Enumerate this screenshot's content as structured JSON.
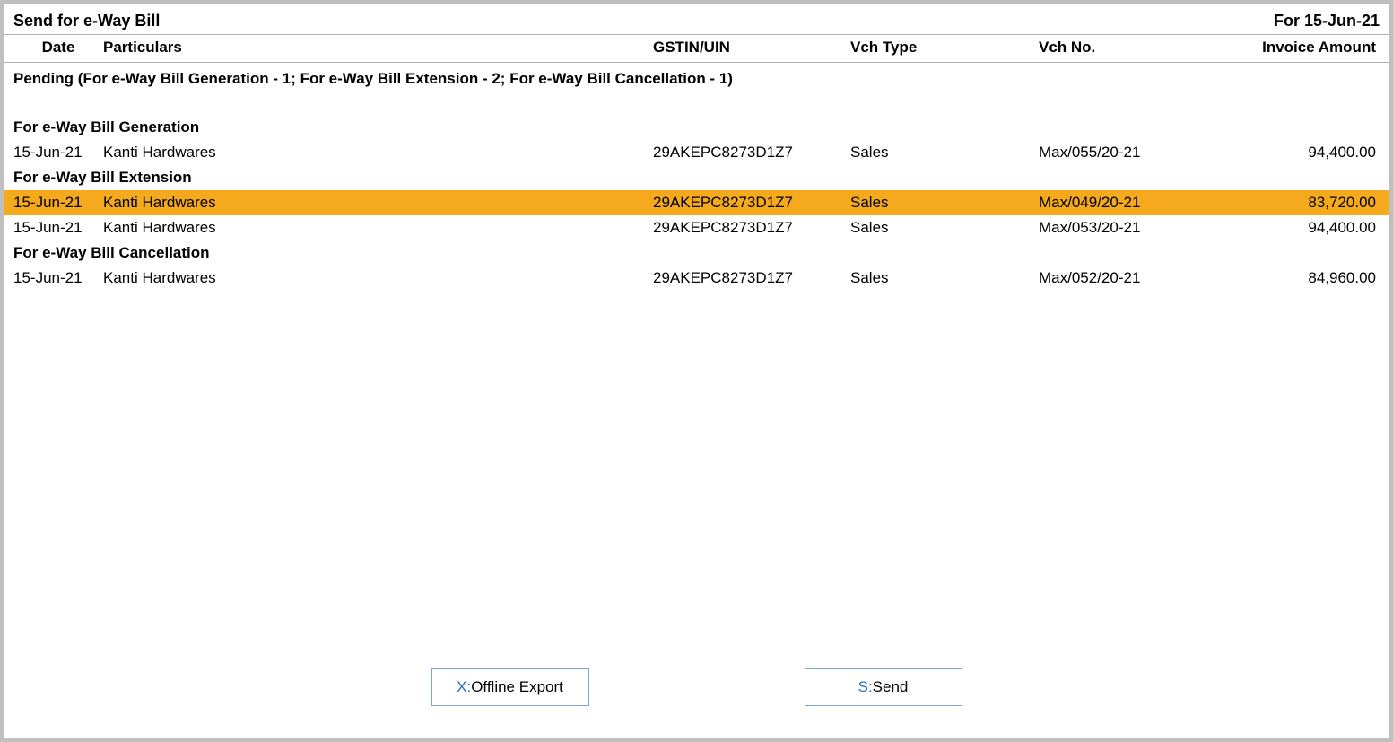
{
  "header": {
    "title": "Send for e-Way Bill",
    "date_label": "For 15-Jun-21"
  },
  "columns": {
    "date": "Date",
    "particulars": "Particulars",
    "gstin": "GSTIN/UIN",
    "vchtype": "Vch Type",
    "vchno": "Vch No.",
    "amount": "Invoice Amount"
  },
  "summary": "Pending (For e-Way Bill Generation - 1; For e-Way Bill Extension - 2; For e-Way Bill Cancellation - 1)",
  "sections": [
    {
      "title": "For e-Way Bill Generation",
      "rows": [
        {
          "date": "15-Jun-21",
          "particulars": "Kanti Hardwares",
          "gstin": "29AKEPC8273D1Z7",
          "vchtype": "Sales",
          "vchno": "Max/055/20-21",
          "amount": "94,400.00",
          "selected": false
        }
      ]
    },
    {
      "title": "For e-Way Bill Extension",
      "rows": [
        {
          "date": "15-Jun-21",
          "particulars": "Kanti Hardwares",
          "gstin": "29AKEPC8273D1Z7",
          "vchtype": "Sales",
          "vchno": "Max/049/20-21",
          "amount": "83,720.00",
          "selected": true
        },
        {
          "date": "15-Jun-21",
          "particulars": "Kanti Hardwares",
          "gstin": "29AKEPC8273D1Z7",
          "vchtype": "Sales",
          "vchno": "Max/053/20-21",
          "amount": "94,400.00",
          "selected": false
        }
      ]
    },
    {
      "title": "For e-Way Bill Cancellation",
      "rows": [
        {
          "date": "15-Jun-21",
          "particulars": "Kanti Hardwares",
          "gstin": "29AKEPC8273D1Z7",
          "vchtype": "Sales",
          "vchno": "Max/052/20-21",
          "amount": "84,960.00",
          "selected": false
        }
      ]
    }
  ],
  "footer": {
    "export_key": "X:",
    "export_label": "Offline Export",
    "send_key": "S:",
    "send_label": "Send"
  }
}
